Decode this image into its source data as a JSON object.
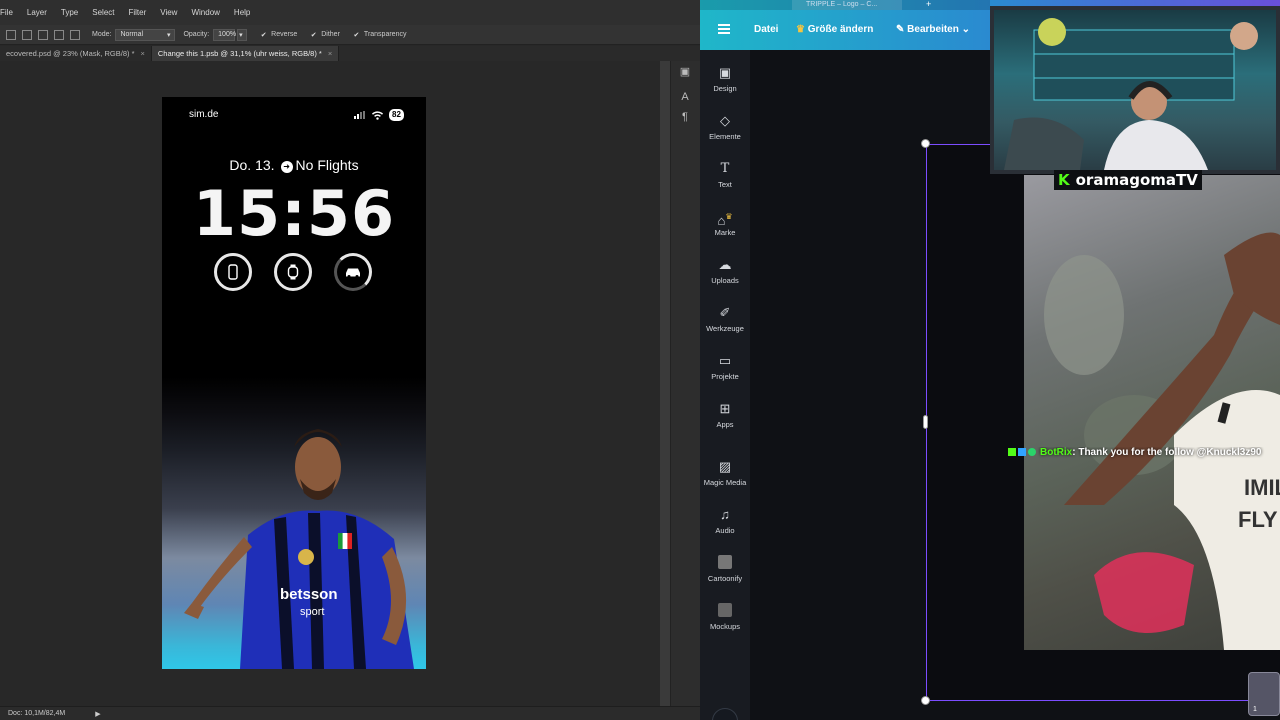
{
  "photoshop": {
    "menu": [
      "File",
      "Layer",
      "Type",
      "Select",
      "Filter",
      "View",
      "Window",
      "Help"
    ],
    "options": {
      "mode_label": "Mode:",
      "mode_value": "Normal",
      "opacity_label": "Opacity:",
      "opacity_value": "100%",
      "reverse_label": "Reverse",
      "dither_label": "Dither",
      "transparency_label": "Transparency"
    },
    "tabs": [
      {
        "label": "ecovered.psd @ 23% (Mask, RGB/8) *"
      },
      {
        "label": "Change this 1.psb @ 31,1% (uhr weiss, RGB/8) *"
      }
    ],
    "status": "Doc: 10,1M/82,4M"
  },
  "phone": {
    "carrier": "sim.de",
    "battery": "82",
    "date": "Do. 13.",
    "flight_text": "No Flights",
    "time": "15:56",
    "widgets": [
      "phone-icon",
      "watch-icon",
      "car-icon"
    ]
  },
  "canva": {
    "browser_tab": "TRIPPLE – Logo – C...",
    "menu": {
      "file": "Datei",
      "resize": "Größe ändern",
      "edit": "Bearbeiten"
    },
    "sidebar": [
      {
        "label": "Design",
        "icon": "layout-icon"
      },
      {
        "label": "Elemente",
        "icon": "shapes-icon"
      },
      {
        "label": "Text",
        "icon": "text-icon"
      },
      {
        "label": "Marke",
        "icon": "brand-icon"
      },
      {
        "label": "Uploads",
        "icon": "cloud-upload-icon"
      },
      {
        "label": "Werkzeuge",
        "icon": "draw-icon"
      },
      {
        "label": "Projekte",
        "icon": "folder-icon"
      },
      {
        "label": "Apps",
        "icon": "apps-icon"
      },
      {
        "label": "Magic Media",
        "icon": "magic-media-icon"
      },
      {
        "label": "Audio",
        "icon": "music-icon"
      },
      {
        "label": "Cartoonify",
        "icon": "cartoonify-icon"
      },
      {
        "label": "Mockups",
        "icon": "mockups-icon"
      }
    ],
    "page_number": "1"
  },
  "stream": {
    "channel": "oramagomaTV",
    "chat_user": "BotRix",
    "chat_message": ": Thank you for the follow @Knuckl3z90"
  }
}
